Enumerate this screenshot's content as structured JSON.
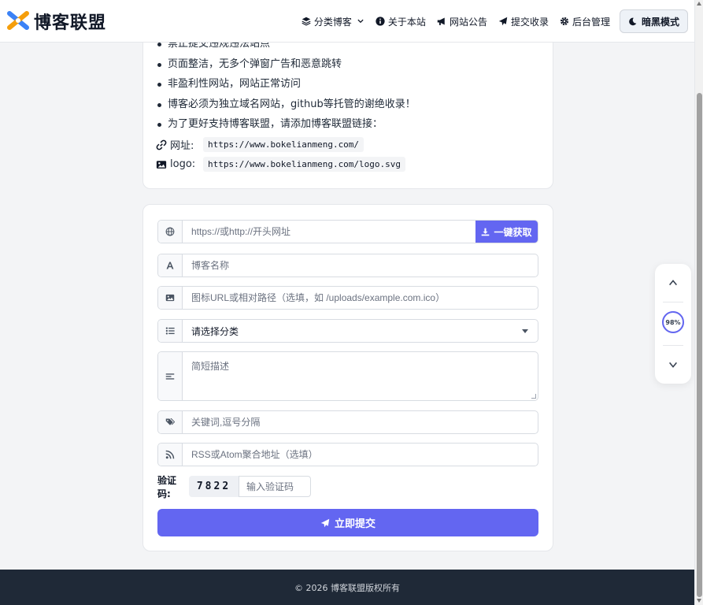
{
  "header": {
    "brand": "博客联盟",
    "nav": [
      {
        "label": "分类博客",
        "icon": "layers-icon"
      },
      {
        "label": "关于本站",
        "icon": "info-icon"
      },
      {
        "label": "网站公告",
        "icon": "megaphone-icon"
      },
      {
        "label": "提交收录",
        "icon": "send-icon"
      },
      {
        "label": "后台管理",
        "icon": "gear-icon"
      }
    ],
    "dark_mode_label": "暗黑模式"
  },
  "rules": {
    "items": [
      "禁止提交违规违法站点",
      "页面整洁，无多个弹窗广告和恶意跳转",
      "非盈利性网站，网站正常访问",
      "博客必须为独立域名网站，github等托管的谢绝收录！",
      "为了更好支持博客联盟，请添加博客联盟链接："
    ],
    "url_label": "网址:",
    "url_value": "https://www.bokelianmeng.com/",
    "logo_label": "logo:",
    "logo_value": "https://www.bokelianmeng.com/logo.svg"
  },
  "form": {
    "url_placeholder": "https://或http://开头网址",
    "fetch_label": "一键获取",
    "name_placeholder": "博客名称",
    "icon_placeholder": "图标URL或相对路径（选填，如 /uploads/example.com.ico）",
    "category_selected": "请选择分类",
    "description_placeholder": "简短描述",
    "keywords_placeholder": "关键词,逗号分隔",
    "rss_placeholder": "RSS或Atom聚合地址（选填）",
    "captcha_label": "验证码:",
    "captcha_code": "7822",
    "captcha_placeholder": "输入验证码",
    "submit_label": "立即提交"
  },
  "widget": {
    "progress_text": "98%",
    "progress_value": 0.98
  },
  "footer": {
    "copyright": "© 2026 博客联盟版权所有"
  },
  "colors": {
    "accent": "#6366f1",
    "footer_bg": "#1f2937"
  }
}
